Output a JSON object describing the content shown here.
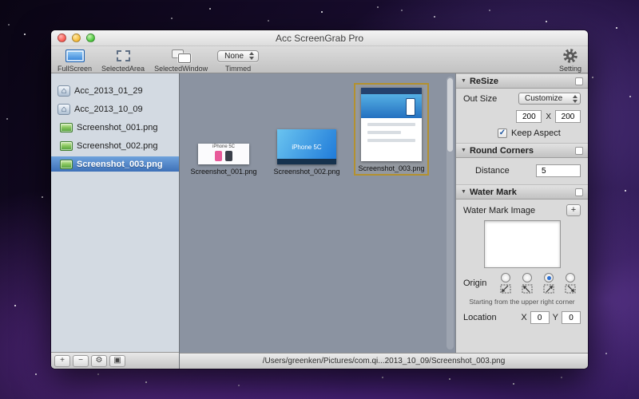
{
  "window": {
    "title": "Acc ScreenGrab Pro"
  },
  "toolbar": {
    "items": [
      {
        "label": "FullScreen"
      },
      {
        "label": "SelectedArea"
      },
      {
        "label": "SelectedWindow"
      }
    ],
    "trimmed": {
      "value": "None",
      "label": "Timmed"
    },
    "setting_label": "Setting"
  },
  "sidebar": {
    "folders": [
      {
        "label": "Acc_2013_01_29"
      },
      {
        "label": "Acc_2013_10_09"
      }
    ],
    "files": [
      {
        "label": "Screenshot_001.png"
      },
      {
        "label": "Screenshot_002.png"
      },
      {
        "label": "Screenshot_003.png"
      }
    ],
    "footer": {
      "add": "+",
      "remove": "−",
      "action": "⚙",
      "view": "▣"
    }
  },
  "content": {
    "thumbnails": [
      {
        "label": "Screenshot_001.png",
        "caption": "iPhone 5C"
      },
      {
        "label": "Screenshot_002.png",
        "caption": "iPhone 5C"
      },
      {
        "label": "Screenshot_003.png"
      }
    ]
  },
  "inspector": {
    "resize": {
      "title": "ReSize",
      "out_size_label": "Out Size",
      "out_size_value": "Customize",
      "width": "200",
      "separator": "X",
      "height": "200",
      "keep_aspect_label": "Keep Aspect"
    },
    "round_corners": {
      "title": "Round Corners",
      "distance_label": "Distance",
      "distance_value": "5"
    },
    "watermark": {
      "title": "Water Mark",
      "image_label": "Water Mark Image",
      "add_button": "+",
      "origin_label": "Origin",
      "hint": "Starting from the upper right corner",
      "location_label": "Location",
      "x_label": "X",
      "x_value": "0",
      "y_label": "Y",
      "y_value": "0"
    }
  },
  "statusbar": {
    "path": "/Users/greenken/Pictures/com.qi...2013_10_09/Screenshot_003.png"
  },
  "icons": {
    "disclosure": "▼",
    "check": "✓",
    "house": "⌂"
  },
  "colors": {
    "accent_blue": "#3e71b8",
    "selection_border": "#b3912f",
    "content_bg": "#8b93a1"
  }
}
